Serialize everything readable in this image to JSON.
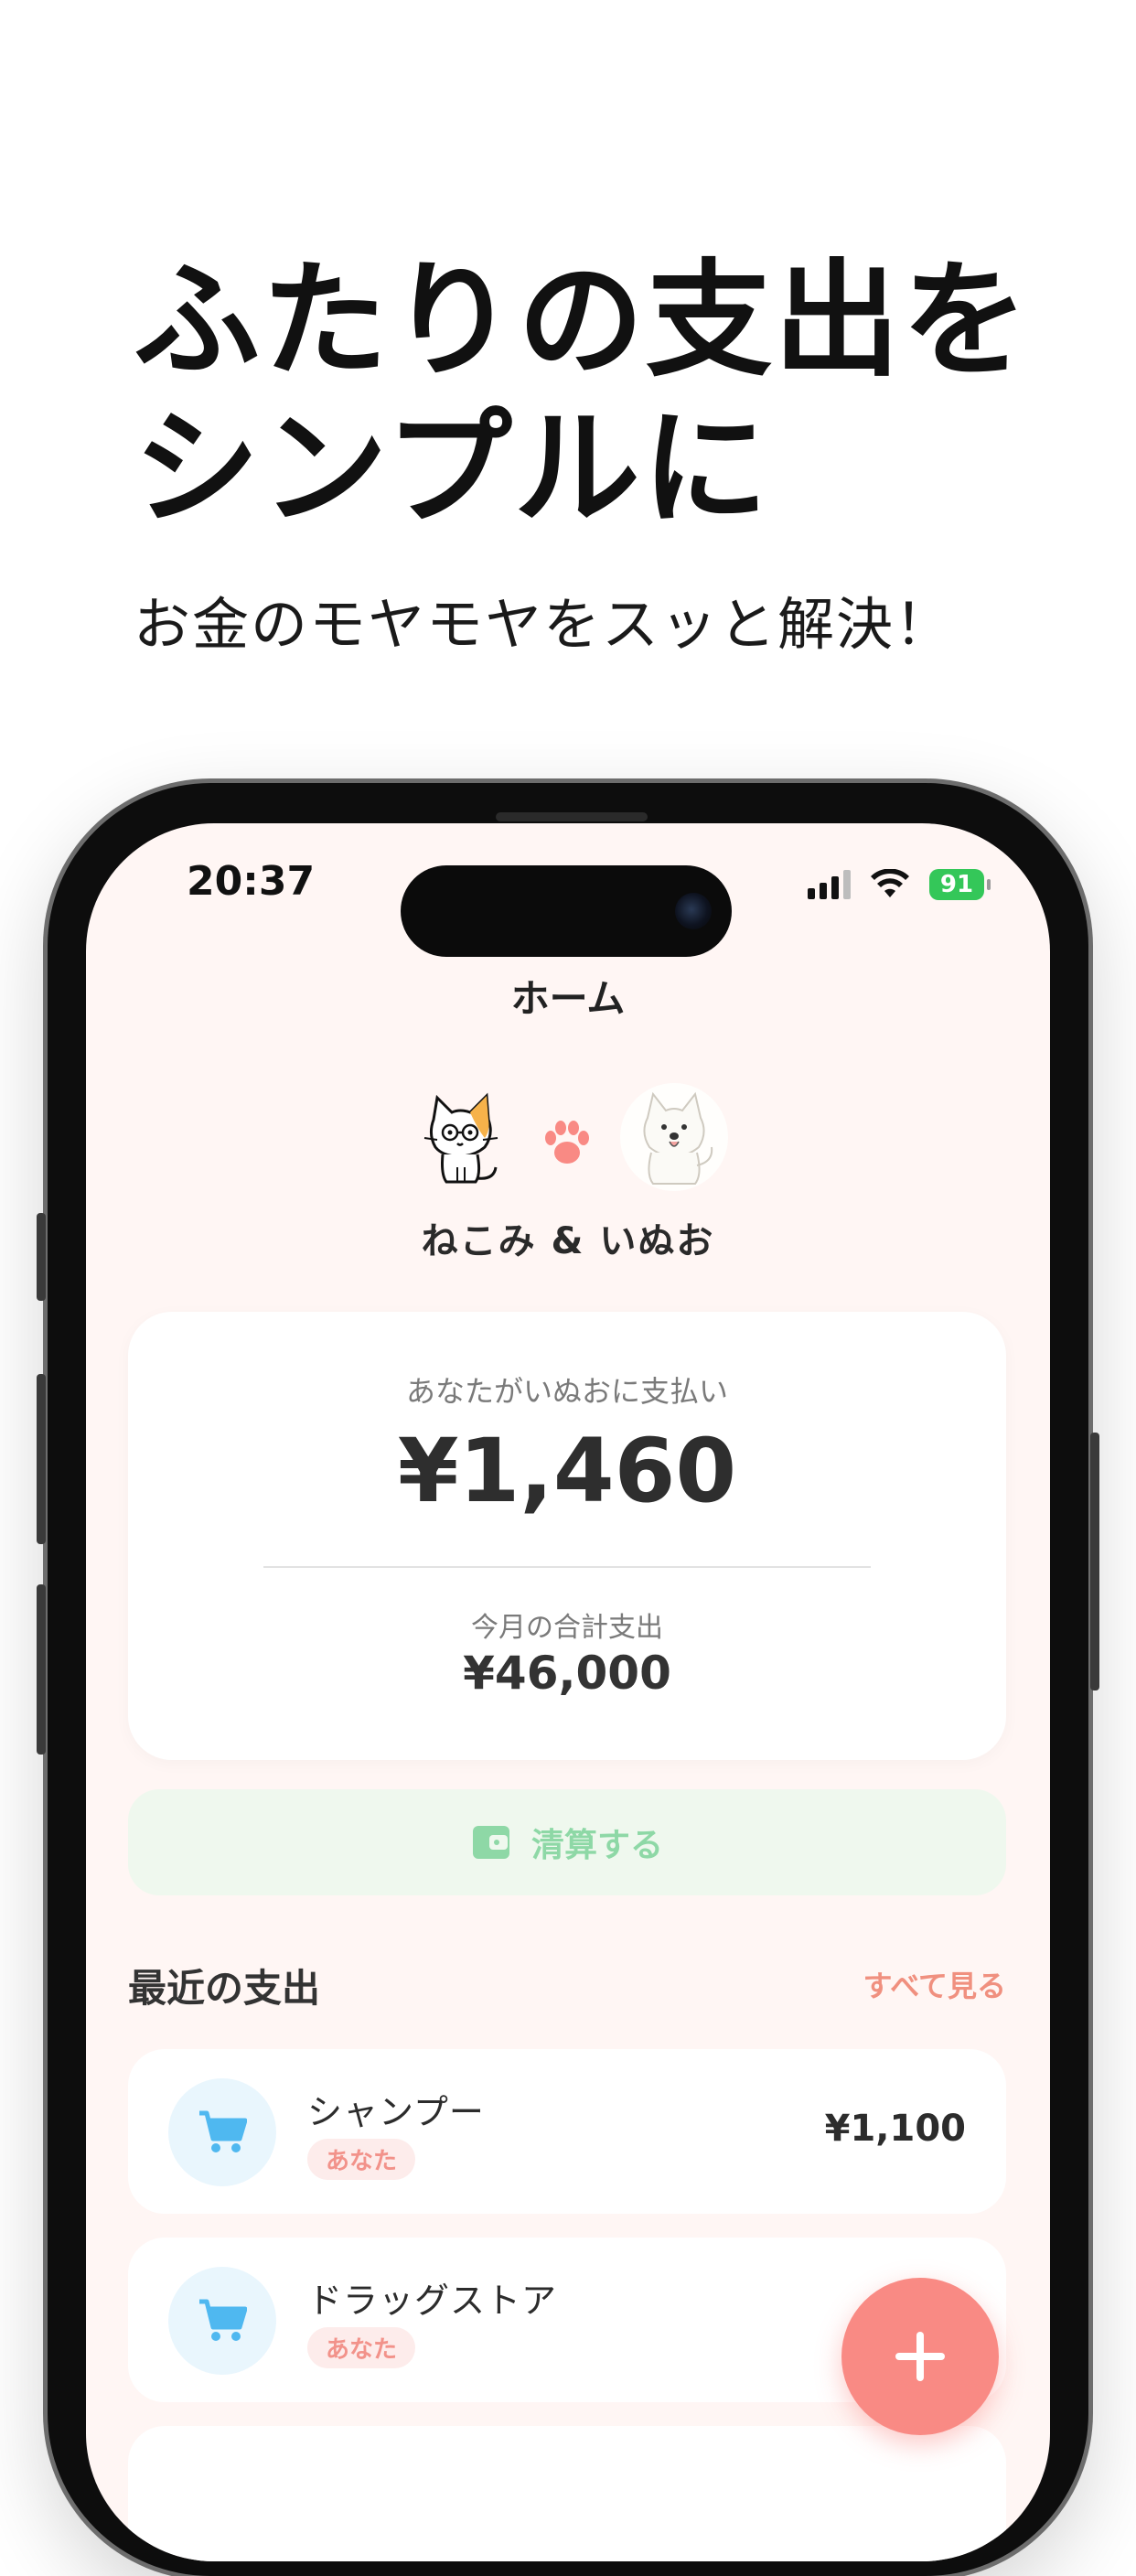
{
  "headline": {
    "line1": "ふたりの支出を",
    "line2": "シンプルに"
  },
  "subheadline": "お金のモヤモヤをスッと解決！",
  "status_bar": {
    "time": "20:37",
    "battery": "91"
  },
  "nav": {
    "title": "ホーム"
  },
  "couple": {
    "names": "ねこみ & いぬお"
  },
  "balance": {
    "label": "あなたがいぬおに支払い",
    "amount": "¥1,460",
    "month_label": "今月の合計支出",
    "month_amount": "¥46,000"
  },
  "settle": {
    "label": "清算する",
    "icon": "wallet-icon"
  },
  "recent": {
    "title": "最近の支出",
    "see_all": "すべて見る",
    "items": [
      {
        "name": "シャンプー",
        "payer": "あなた",
        "amount": "¥1,100",
        "icon": "cart-icon"
      },
      {
        "name": "ドラッグストア",
        "payer": "あなた",
        "amount": "¥",
        "icon": "cart-icon"
      }
    ]
  },
  "fab": {
    "icon": "plus-icon"
  },
  "colors": {
    "accent": "#f98a84",
    "screen_bg": "#fff6f4",
    "settle_green": "#8ed8a6",
    "tag_bg": "#fdeceb",
    "cart_blue": "#4fb8f0"
  }
}
